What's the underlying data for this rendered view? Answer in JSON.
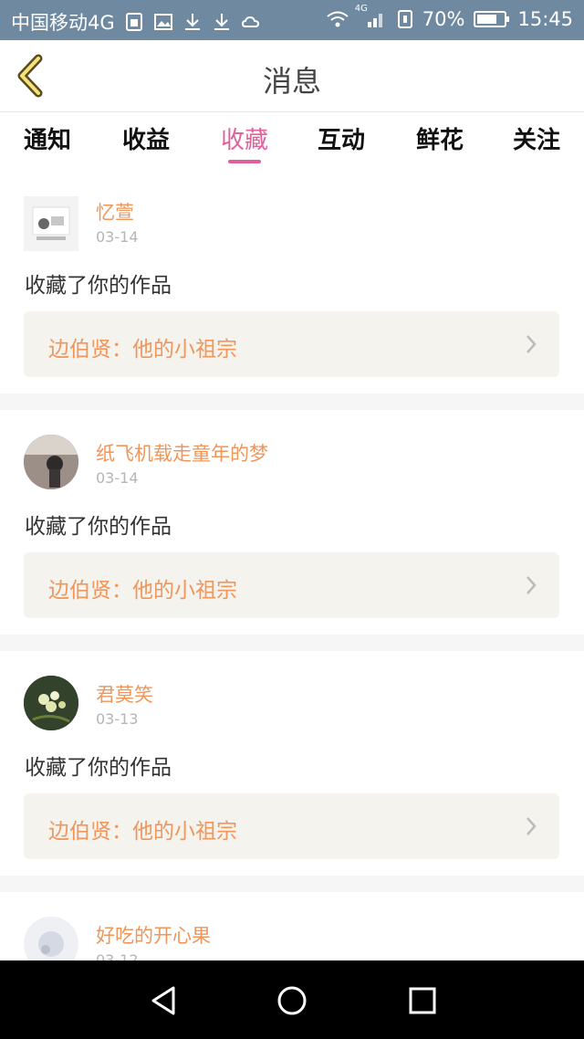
{
  "status_bar": {
    "carrier": "中国移动4G",
    "network_badge": "4G",
    "battery": "70%",
    "time": "15:45"
  },
  "header": {
    "title": "消息"
  },
  "tabs": [
    {
      "label": "通知",
      "active": false
    },
    {
      "label": "收益",
      "active": false
    },
    {
      "label": "收藏",
      "active": true
    },
    {
      "label": "互动",
      "active": false
    },
    {
      "label": "鲜花",
      "active": false
    },
    {
      "label": "关注",
      "active": false
    }
  ],
  "feed": [
    {
      "name": "忆萱",
      "date": "03-14",
      "action": "收藏了你的作品",
      "work": "边伯贤：他的小祖宗"
    },
    {
      "name": "纸飞机载走童年的梦",
      "date": "03-14",
      "action": "收藏了你的作品",
      "work": "边伯贤：他的小祖宗"
    },
    {
      "name": "君莫笑",
      "date": "03-13",
      "action": "收藏了你的作品",
      "work": "边伯贤：他的小祖宗"
    },
    {
      "name": "好吃的开心果",
      "date": "03-12",
      "action": "",
      "work": ""
    }
  ],
  "colors": {
    "accent": "#e0609a",
    "name": "#f0965a",
    "status_bar": "#6f8aa0"
  },
  "icons": {
    "back": "chevron-left-icon",
    "nav_back": "triangle-back-icon",
    "nav_home": "circle-home-icon",
    "nav_recents": "square-recents-icon"
  }
}
